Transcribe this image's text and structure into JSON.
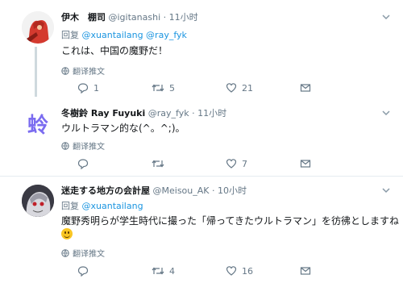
{
  "tweets": [
    {
      "name": "伊木　棚司",
      "handle": "@igitanashi",
      "dot": "·",
      "time": "11小时",
      "reply_prefix": "回复",
      "reply_to": "@xuantailang @ray_fyk",
      "text": "これは、中国の魔野だ！",
      "translate": "翻译推文",
      "replies": "1",
      "retweets": "5",
      "likes": "21"
    },
    {
      "name": "冬樹鈴 Ray Fuyuki",
      "handle": "@ray_fyk",
      "dot": "·",
      "time": "11小时",
      "avatar_char": "蛉",
      "text": "ウルトラマン的な(^。^;)。",
      "translate": "翻译推文",
      "replies": "",
      "retweets": "",
      "likes": "7"
    },
    {
      "name": "迷走する地方の会計屋",
      "handle": "@Meisou_AK",
      "dot": "·",
      "time": "10小时",
      "reply_prefix": "回复",
      "reply_to": "@xuantailang",
      "text": "魔野秀明らが学生時代に撮った「帰ってきたウルトラマン」を彷彿としますね",
      "translate": "翻译推文",
      "replies": "",
      "retweets": "4",
      "likes": "16"
    }
  ],
  "icons": {
    "reply": "reply-icon",
    "retweet": "retweet-icon",
    "like": "heart-icon",
    "dm": "direct-message-icon",
    "translate": "globe-icon",
    "caret": "chevron-down-icon"
  },
  "colors": {
    "link": "#1b95e0",
    "secondary": "#657786",
    "avatar2_text": "#7b6cf0"
  }
}
